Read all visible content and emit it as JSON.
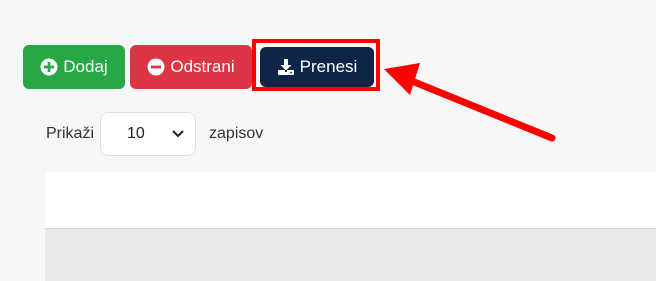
{
  "toolbar": {
    "add_label": "Dodaj",
    "remove_label": "Odstrani",
    "download_label": "Prenesi",
    "add_icon": "plus-circle-icon",
    "remove_icon": "minus-circle-icon",
    "download_icon": "download-icon"
  },
  "length_control": {
    "prefix": "Prikaži",
    "selected": "10",
    "suffix": "zapisov"
  },
  "colors": {
    "add": "#27a844",
    "remove": "#dc3545",
    "download": "#0f2548",
    "annotation": "#ff0000"
  }
}
